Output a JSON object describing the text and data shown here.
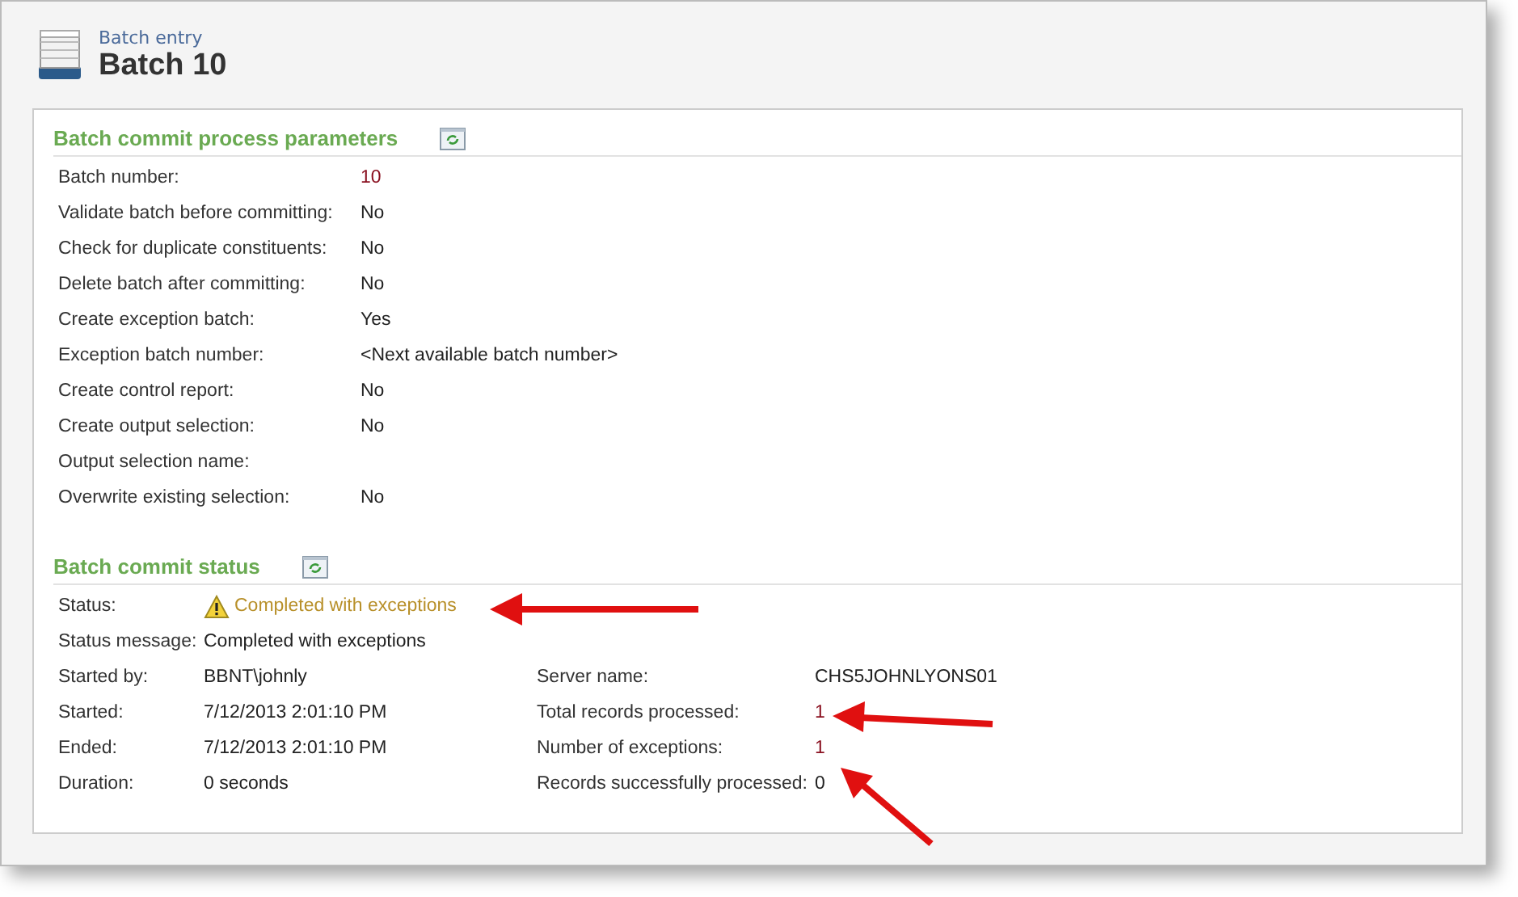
{
  "header": {
    "breadcrumb": "Batch entry",
    "title": "Batch 10"
  },
  "parameters": {
    "title": "Batch commit process parameters",
    "rows": [
      {
        "label": "Batch number:",
        "value": "10",
        "kind": "accent"
      },
      {
        "label": "Validate batch before committing:",
        "value": "No",
        "kind": "plain"
      },
      {
        "label": "Check for duplicate constituents:",
        "value": "No",
        "kind": "plain"
      },
      {
        "label": "Delete batch after committing:",
        "value": "No",
        "kind": "plain"
      },
      {
        "label": "Create exception batch:",
        "value": "Yes",
        "kind": "plain"
      },
      {
        "label": "Exception batch number:",
        "value": "<Next available batch number>",
        "kind": "plain"
      },
      {
        "label": "Create control report:",
        "value": "No",
        "kind": "plain"
      },
      {
        "label": "Create output selection:",
        "value": "No",
        "kind": "plain"
      },
      {
        "label": "Output selection name:",
        "kind": "plain"
      },
      {
        "label": "Overwrite existing selection:",
        "value": "No",
        "kind": "plain"
      }
    ]
  },
  "status": {
    "title": "Batch commit status",
    "top_rows": [
      {
        "label": "Status:",
        "value": "Completed with exceptions",
        "kind": "warning"
      },
      {
        "label": "Status message:",
        "value": "Completed with exceptions",
        "kind": "plain"
      }
    ],
    "left_rows": [
      {
        "label": "Started by:",
        "value": "BBNT\\johnly",
        "kind": "plain"
      },
      {
        "label": "Started:",
        "value": "7/12/2013 2:01:10 PM",
        "kind": "plain"
      },
      {
        "label": "Ended:",
        "value": "7/12/2013 2:01:10 PM",
        "kind": "plain"
      },
      {
        "label": "Duration:",
        "value": "0 seconds",
        "kind": "plain"
      }
    ],
    "right_rows": [
      {
        "label": "Server name:",
        "value": "CHS5JOHNLYONS01",
        "kind": "plain"
      },
      {
        "label": "Total records processed:",
        "value": "1",
        "kind": "accent"
      },
      {
        "label": "Number of exceptions:",
        "value": "1",
        "kind": "accent"
      },
      {
        "label": "Records successfully processed:",
        "value": "0",
        "kind": "plain"
      }
    ]
  }
}
